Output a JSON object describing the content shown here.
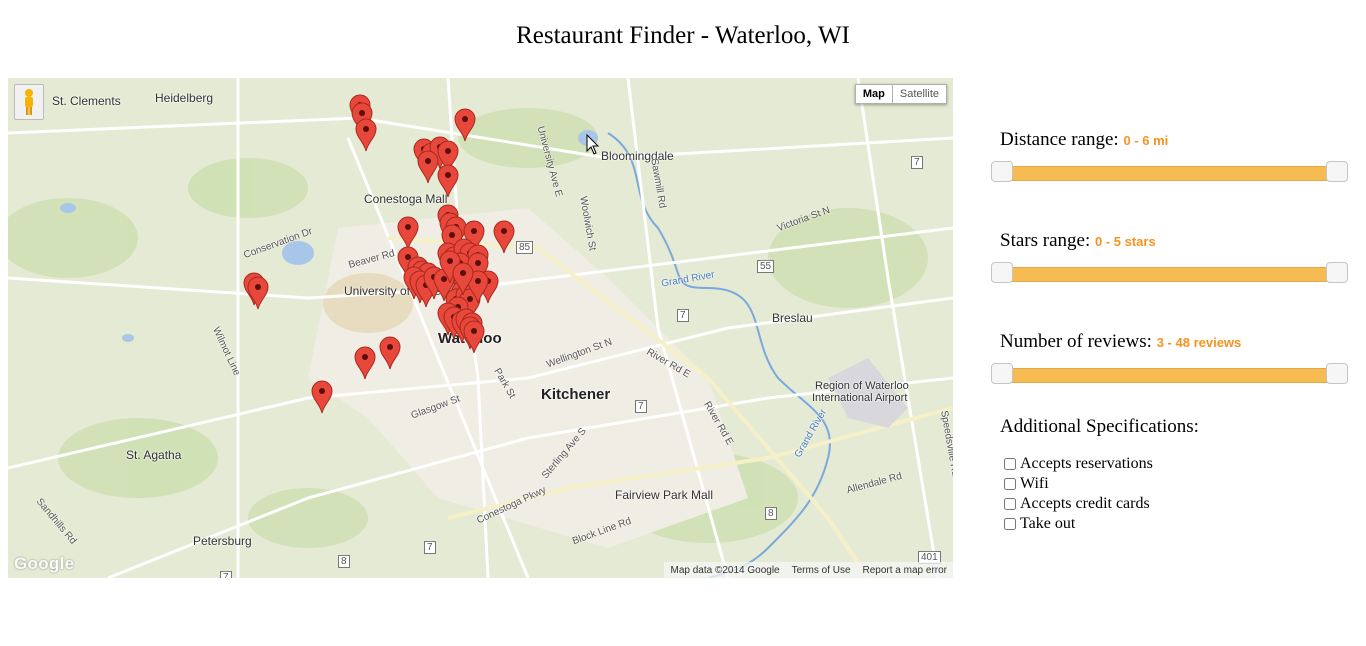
{
  "page": {
    "title": "Restaurant Finder - Waterloo, WI"
  },
  "map": {
    "type_buttons": {
      "map": "Map",
      "satellite": "Satellite"
    },
    "attribution": {
      "data": "Map data ©2014 Google",
      "terms": "Terms of Use",
      "report": "Report a map error"
    },
    "logo_text": "Google",
    "places": [
      "St. Clements",
      "Heidelberg",
      "Bloomingdale",
      "Conestoga Mall",
      "University of Waterloo",
      "Waterloo",
      "Kitchener",
      "Breslau",
      "Region of Waterloo",
      "International Airport",
      "St. Agatha",
      "Petersburg",
      "Fairview Park Mall"
    ],
    "roads": [
      "Conservation Dr",
      "Wilmot Line",
      "University Ave E",
      "Woolwich St",
      "Sawmill Rd",
      "Victoria St N",
      "Grand River",
      "Wellington St N",
      "River Rd E",
      "Glasgow St",
      "Conestoga Pkwy",
      "Block Line Rd",
      "Allendale Rd",
      "Speedsville Rd",
      "Sandhills Rd",
      "Beaver Rd",
      "Park St",
      "Sterling Ave S",
      "River Rd E",
      "Grand River"
    ],
    "highway_shields": [
      "85",
      "55",
      "7",
      "7",
      "7",
      "8",
      "8",
      "7",
      "401",
      "7"
    ],
    "marker_color": "#e8483b",
    "marker_count_visible": 60
  },
  "filters": {
    "distance": {
      "label": "Distance range:",
      "value": "0 - 6 mi"
    },
    "stars": {
      "label": "Stars range:",
      "value": "0 - 5 stars"
    },
    "reviews": {
      "label": "Number of reviews:",
      "value": "3 - 48 reviews"
    },
    "accent_color": "#f6931f",
    "track_color": "#f7bc51"
  },
  "specifications": {
    "heading": "Additional Specifications:",
    "options": [
      "Accepts reservations",
      "Wifi",
      "Accepts credit cards",
      "Take out"
    ]
  }
}
